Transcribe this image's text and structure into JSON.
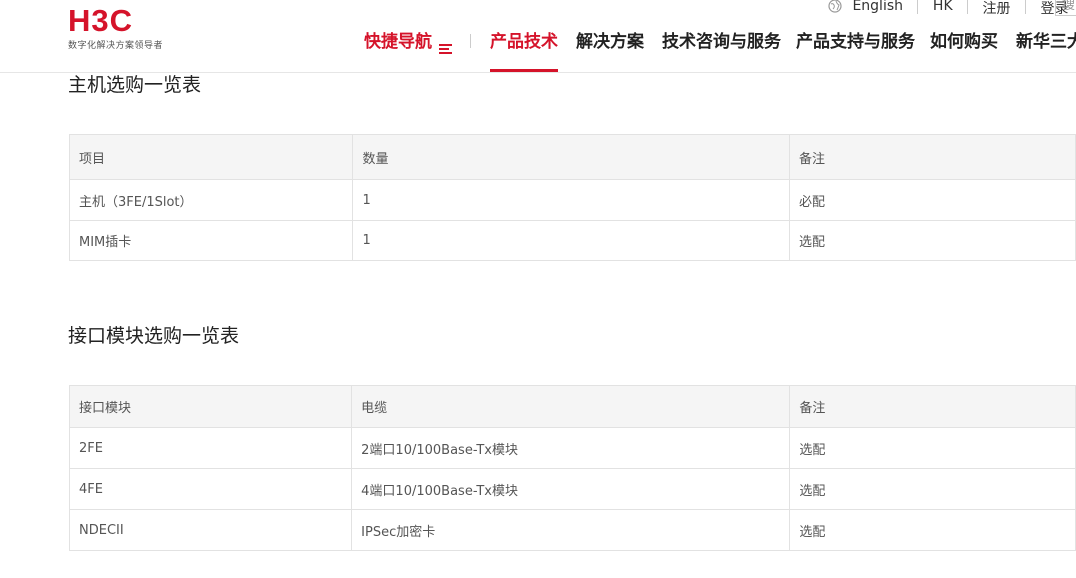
{
  "logo": {
    "mark": "H3C",
    "tagline": "数字化解决方案领导者"
  },
  "top_links": {
    "language": "English",
    "region": "HK",
    "register": "注册",
    "login": "登录",
    "search_placeholder": "搜"
  },
  "nav": {
    "quick": "快捷导航",
    "items": [
      "产品技术",
      "解决方案",
      "技术咨询与服务",
      "产品支持与服务",
      "如何购买",
      "新华三大"
    ]
  },
  "host_section": {
    "title": "主机选购一览表",
    "headers": [
      "项目",
      "数量",
      "备注"
    ],
    "rows": [
      [
        "主机（3FE/1Slot）",
        "1",
        "必配"
      ],
      [
        "MIM插卡",
        "1",
        "选配"
      ]
    ]
  },
  "interface_section": {
    "title": "接口模块选购一览表",
    "headers": [
      "接口模块",
      "电缆",
      "备注"
    ],
    "rows": [
      [
        "2FE",
        "2端口10/100Base-Tx模块",
        "选配"
      ],
      [
        "4FE",
        "4端口10/100Base-Tx模块",
        "选配"
      ],
      [
        "NDECII",
        "IPSec加密卡",
        "选配"
      ]
    ]
  },
  "colors": {
    "brand": "#d5132a",
    "header_row": "#f5f5f5",
    "border": "#e2e2e2"
  },
  "icons": [
    "globe-icon",
    "menu-icon"
  ]
}
